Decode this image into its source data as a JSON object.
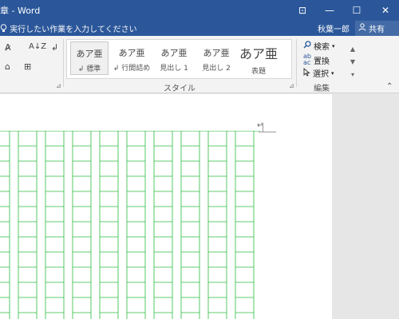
{
  "titlebar": {
    "title": "章 - Word",
    "buttons": {
      "ribbon_display": "⊡",
      "minimize": "—",
      "maximize": "☐",
      "close": "✕"
    }
  },
  "tellme": {
    "icon": "lightbulb-icon",
    "placeholder": "実行したい作業を入力してください",
    "user": "秋葉一郎",
    "share_label": "共有"
  },
  "ribbon": {
    "font_tools": {
      "clear_format": "A̷",
      "sort": "A↓Z",
      "show_marks": "↲",
      "shading": "⌂",
      "borders": "⊞"
    },
    "styles": {
      "group_label": "スタイル",
      "items": [
        {
          "sample": "あア亜",
          "label": "↲ 標準"
        },
        {
          "sample": "あア亜",
          "label": "↲ 行間詰め"
        },
        {
          "sample": "あア亜",
          "label": "見出し 1"
        },
        {
          "sample": "あア亜",
          "label": "見出し 2"
        },
        {
          "sample": "あア亜",
          "label": "表題"
        }
      ],
      "scroll": [
        "▲",
        "▼",
        "▾"
      ]
    },
    "editing": {
      "group_label": "編集",
      "find": "検索",
      "replace": "置換",
      "select": "選択"
    }
  },
  "document": {
    "paragraph_mark": "↵",
    "grid_color": "#2bbb3f",
    "columns": 10,
    "rows": 12
  },
  "colors": {
    "titlebar": "#2b579a",
    "ribbon": "#f3f3f3",
    "page": "#ffffff",
    "grid": "#2bbb3f"
  }
}
